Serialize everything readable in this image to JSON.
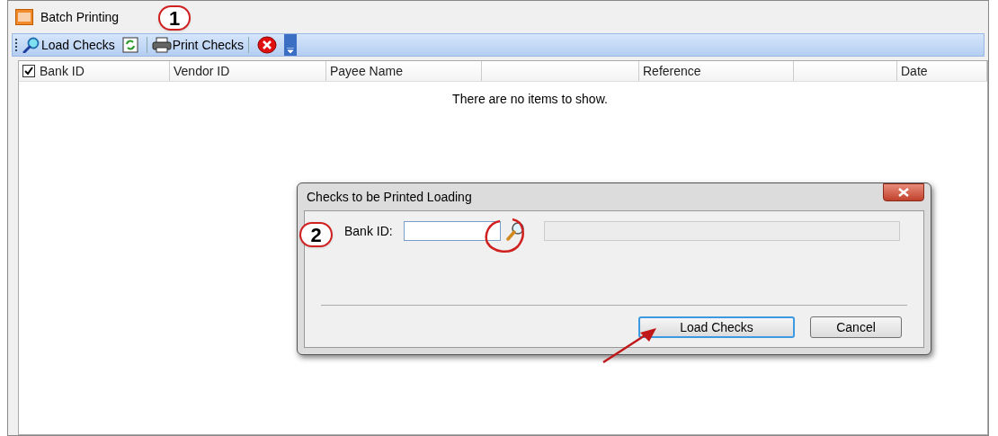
{
  "window": {
    "title": "Batch Printing",
    "callout": "1"
  },
  "toolbar": {
    "buttons": [
      {
        "kind": "load",
        "label": "Load Checks"
      },
      {
        "kind": "refresh"
      },
      {
        "kind": "print",
        "label": "Print Checks"
      },
      {
        "kind": "cancel"
      }
    ]
  },
  "table": {
    "select_all_checked": true,
    "columns": [
      {
        "label": "Bank ID"
      },
      {
        "label": "Vendor ID"
      },
      {
        "label": "Payee Name"
      },
      {},
      {
        "label": "Reference"
      },
      {},
      {
        "label": "Date"
      }
    ],
    "empty_message": "There are no items to show."
  },
  "dialog": {
    "title": "Checks to be Printed Loading",
    "callout": "2",
    "field_label": "Bank ID:",
    "buttons": [
      {
        "label": "Load Checks",
        "default": true
      },
      {
        "label": "Cancel",
        "default": false
      }
    ]
  }
}
